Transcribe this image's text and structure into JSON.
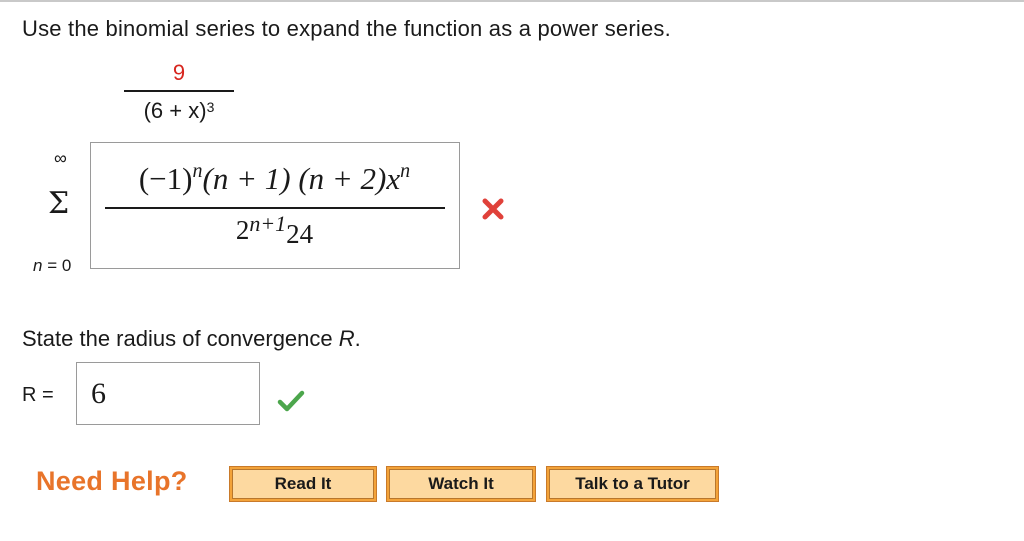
{
  "prompt": "Use the binomial series to expand the function as a power series.",
  "function": {
    "numerator": "9",
    "denominator_base": "(6 + x)",
    "denominator_exponent": "3",
    "numerator_color": "#d7261e"
  },
  "sigma": {
    "upper": "∞",
    "symbol": "Σ",
    "lower": "n = 0"
  },
  "answer": {
    "numerator_a": "(−1)",
    "numerator_a_exp": "n",
    "numerator_b": "(n + 1) (n + 2)x",
    "numerator_b_exp": "n",
    "denominator_base": "2",
    "denominator_exp": "n+1",
    "denominator_tail": "24",
    "status_icon": "x-mark-icon",
    "status_color": "#e0413a"
  },
  "radius": {
    "prompt_text": "State the radius of convergence ",
    "prompt_var": "R",
    "prompt_end": ".",
    "label": "R =",
    "value": "6",
    "status_icon": "check-mark-icon",
    "status_color": "#4ca64c"
  },
  "help": {
    "title": "Need Help?",
    "read_it": "Read It",
    "watch_it": "Watch It",
    "talk_to_tutor": "Talk to a Tutor",
    "title_color": "#e8742a"
  }
}
